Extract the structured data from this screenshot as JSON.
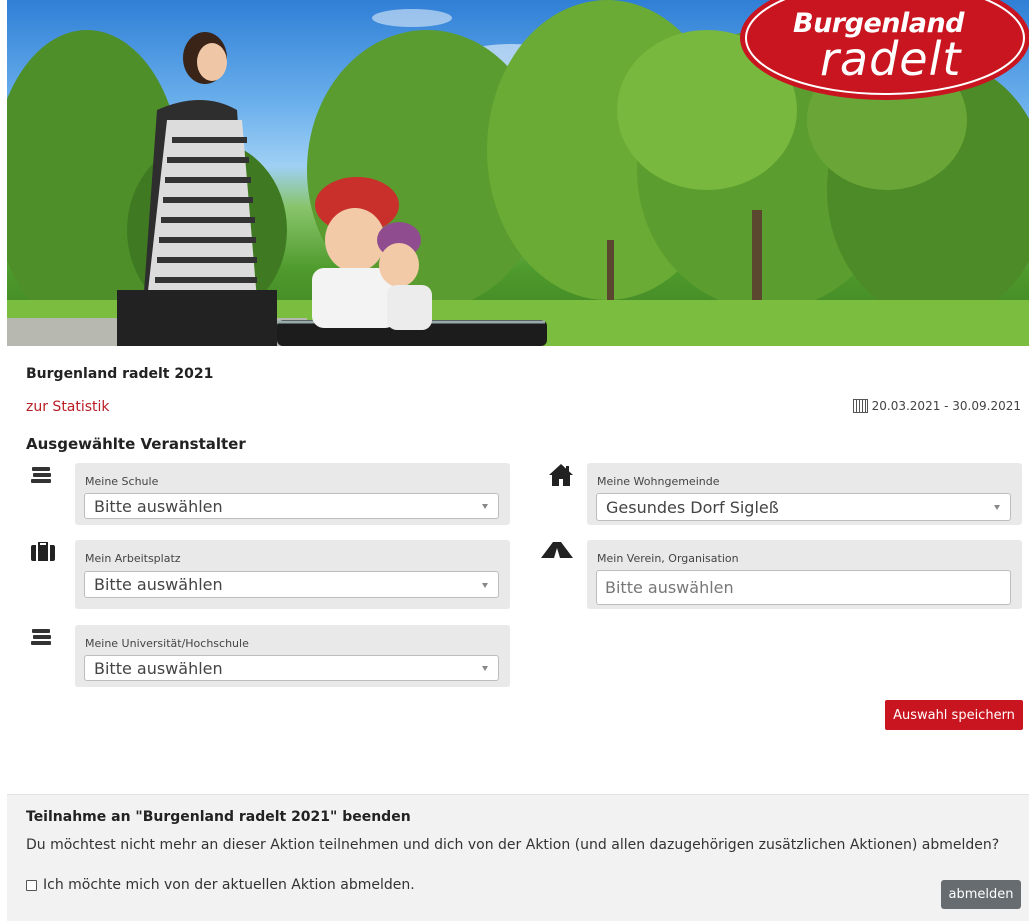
{
  "banner": {
    "logo_line1": "Burgenland",
    "logo_line2": "radelt"
  },
  "event": {
    "title": "Burgenland radelt 2021",
    "stats_link": "zur Statistik",
    "date_range": "20.03.2021 - 30.09.2021"
  },
  "organizers": {
    "title": "Ausgewählte Veranstalter",
    "school": {
      "label": "Meine Schule",
      "value": "Bitte auswählen",
      "icon": "books-icon"
    },
    "workplace": {
      "label": "Mein Arbeitsplatz",
      "value": "Bitte auswählen",
      "icon": "briefcase-icon"
    },
    "university": {
      "label": "Meine Universität/Hochschule",
      "value": "Bitte auswählen",
      "icon": "books-icon"
    },
    "municipality": {
      "label": "Meine Wohngemeinde",
      "value": "Gesundes Dorf Sigleß",
      "icon": "home-icon"
    },
    "club": {
      "label": "Mein Verein, Organisation",
      "placeholder": "Bitte auswählen",
      "icon": "tent-icon"
    },
    "save_button": "Auswahl speichern"
  },
  "leave": {
    "title": "Teilnahme an \"Burgenland radelt 2021\" beenden",
    "question": "Du möchtest nicht mehr an dieser Aktion teilnehmen und dich von der Aktion (und allen dazugehörigen zusätzlichen Aktionen) abmelden?",
    "checkbox_label": "Ich möchte mich von der aktuellen Aktion abmelden.",
    "button": "abmelden"
  },
  "colors": {
    "accent": "#c8151f",
    "link": "#b81d24",
    "panel": "#e9e9e9",
    "secondary_button": "#666c70"
  }
}
